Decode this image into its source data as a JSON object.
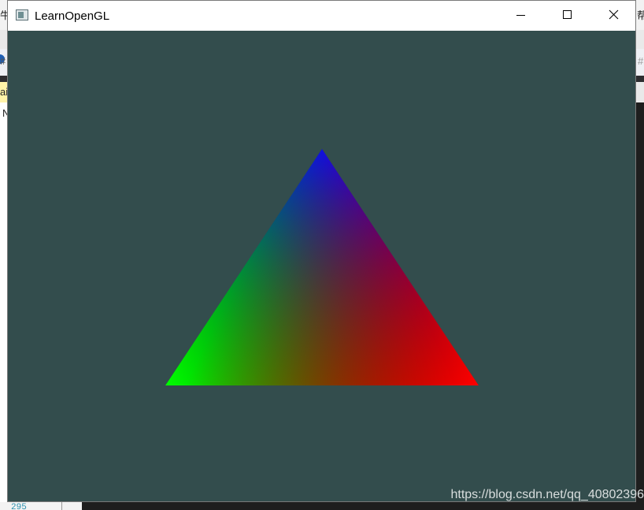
{
  "window": {
    "title": "LearnOpenGL",
    "clear_color": "#334d4d"
  },
  "caption_buttons": {
    "minimize_icon": "minimize-icon",
    "maximize_icon": "maximize-icon",
    "close_icon": "close-icon"
  },
  "triangle": {
    "vertex_colors": {
      "top": "#0000ff",
      "bottom_left": "#00ff00",
      "bottom_right": "#ff0000"
    }
  },
  "watermark": {
    "text": "https://blog.csdn.net/qq_40802396"
  },
  "background": {
    "fragments": {
      "top_left": "牛",
      "top_right": "帮",
      "hash_left": "#",
      "hash_right": "#",
      "tab": "ai",
      "n_char": "N",
      "line_number": "295"
    }
  }
}
